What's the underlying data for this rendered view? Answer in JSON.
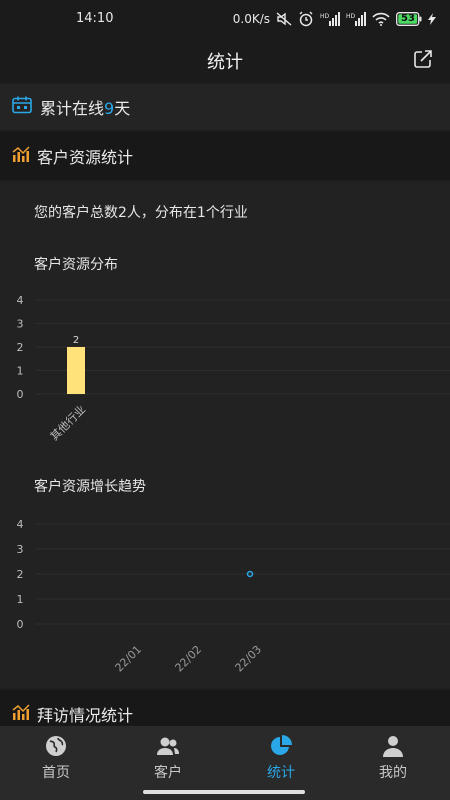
{
  "status_bar": {
    "time": "14:10",
    "net_speed": "0.0K/s",
    "battery": "53",
    "icons": [
      "mute-icon",
      "alarm-icon",
      "hd-signal-icon",
      "hd-signal-icon",
      "wifi-icon",
      "battery-icon",
      "charging-icon"
    ]
  },
  "header": {
    "title": "统计",
    "share_icon": "share-icon"
  },
  "online": {
    "prefix": "累计在线",
    "days": "9",
    "suffix": "天",
    "icon": "calendar-icon"
  },
  "sections": {
    "customer": {
      "title": "客户资源统计",
      "icon": "trend-chart-icon"
    },
    "visits": {
      "title": "拜访情况统计",
      "icon": "trend-chart-icon"
    }
  },
  "summary_text": "您的客户总数2人，分布在1个行业",
  "chart_data": [
    {
      "type": "bar",
      "title": "客户资源分布",
      "categories": [
        "其他行业"
      ],
      "values": [
        2
      ],
      "data_labels": [
        "2"
      ],
      "ylim": [
        0,
        4
      ],
      "yticks": [
        "0",
        "1",
        "2",
        "3",
        "4"
      ],
      "grid": true,
      "bar_color": "#ffe27a"
    },
    {
      "type": "line",
      "title": "客户资源增长趋势",
      "x": [
        "22/01",
        "22/02",
        "22/03"
      ],
      "series": [
        {
          "values": [
            null,
            null,
            2
          ]
        }
      ],
      "ylim": [
        0,
        4
      ],
      "yticks": [
        "0",
        "1",
        "2",
        "3",
        "4"
      ],
      "grid": true,
      "line_color": "#2aa7e6"
    }
  ],
  "nav": [
    {
      "label": "首页",
      "icon": "home-globe-icon",
      "active": false
    },
    {
      "label": "客户",
      "icon": "customers-icon",
      "active": false
    },
    {
      "label": "统计",
      "icon": "stats-pie-icon",
      "active": true
    },
    {
      "label": "我的",
      "icon": "profile-icon",
      "active": false
    }
  ],
  "colors": {
    "accent": "#2aa7e6",
    "section_icon": "#f0a030",
    "bar": "#ffe27a"
  }
}
